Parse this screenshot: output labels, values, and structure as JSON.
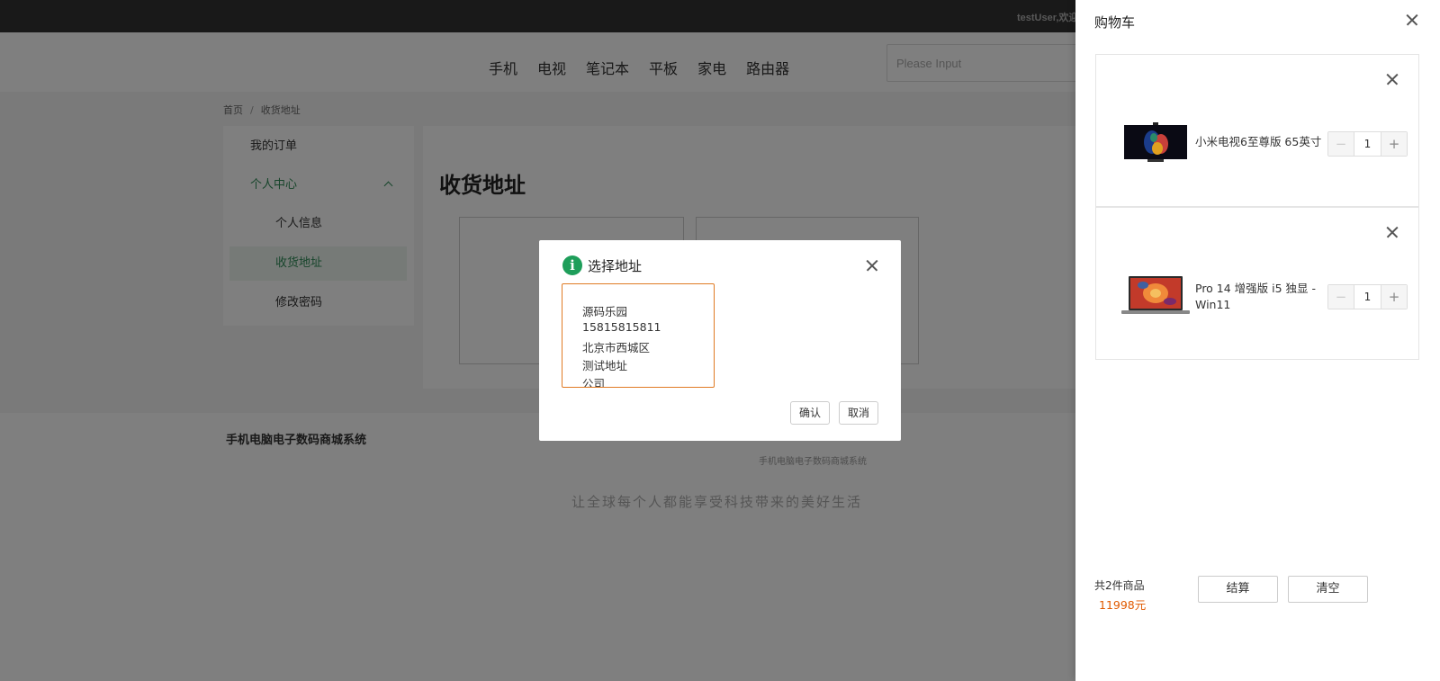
{
  "topbar": {
    "user_text": "testUser,欢迎"
  },
  "nav": {
    "items": [
      "手机",
      "电视",
      "笔记本",
      "平板",
      "家电",
      "路由器"
    ]
  },
  "search": {
    "placeholder": "Please Input",
    "value": ""
  },
  "breadcrumb": {
    "home": "首页",
    "separator": "/",
    "current": "收货地址"
  },
  "sidebar": {
    "orders": "我的订单",
    "center": "个人中心",
    "info": "个人信息",
    "address": "收货地址",
    "password": "修改密码"
  },
  "main": {
    "title": "收货地址"
  },
  "footer": {
    "title": "手机电脑电子数码商城系统",
    "small": "手机电脑电子数码商城系统",
    "slogan": "让全球每个人都能享受科技带来的美好生活"
  },
  "dialog": {
    "title": "选择地址",
    "address": {
      "name": "源码乐园",
      "phone": "15815815811",
      "region": "北京市西城区",
      "detail": "测试地址",
      "tag": "公司"
    },
    "confirm": "确认",
    "cancel": "取消"
  },
  "cart": {
    "title": "购物车",
    "items": [
      {
        "name": "小米电视6至尊版 65英寸",
        "quantity": "1",
        "image": "tv-image"
      },
      {
        "name": "Pro 14 增强版 i5 独显 - Win11",
        "quantity": "1",
        "image": "laptop-image"
      }
    ],
    "count_text": "共2件商品",
    "total": "11998元",
    "checkout": "结算",
    "clear": "清空"
  },
  "colors": {
    "accent_green": "#2e8b57",
    "price_orange": "#e05a00",
    "selected_border": "#e07b24"
  }
}
